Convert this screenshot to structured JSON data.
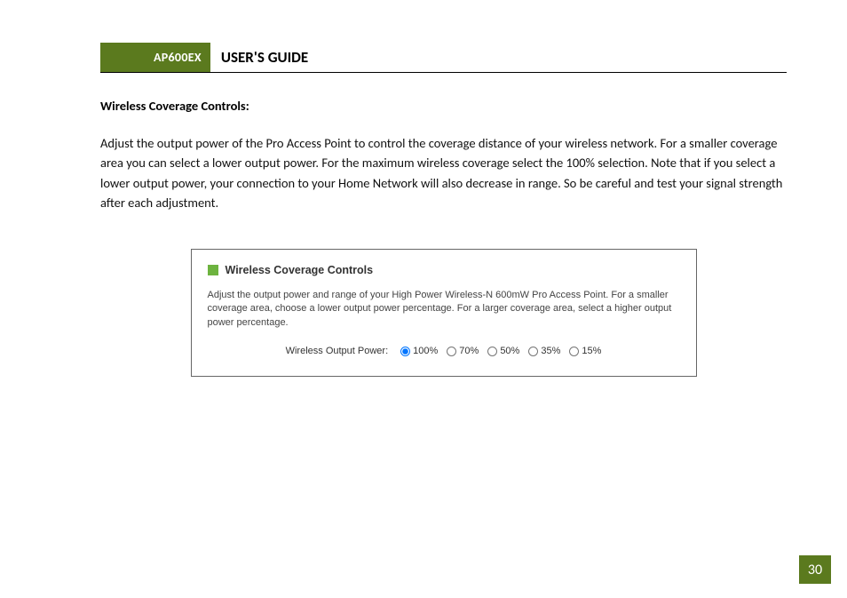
{
  "header": {
    "badge": "AP600EX",
    "title": "USER'S GUIDE"
  },
  "section": {
    "heading": "Wireless Coverage Controls:",
    "body": "Adjust the output power of the Pro Access Point to control the coverage distance of your wireless network.  For a smaller coverage area you can select a lower output power.  For the maximum wireless coverage select the 100% selection.  Note that if you select a lower output power, your connection to your Home Network will also decrease in range.  So be careful and test your signal strength after each adjustment."
  },
  "figure": {
    "title": "Wireless Coverage Controls",
    "desc": "Adjust the output power and range of your High Power Wireless-N 600mW Pro Access Point. For a smaller coverage area, choose a lower output power percentage. For a larger coverage area, select a higher output power percentage.",
    "radio_label": "Wireless Output Power:",
    "options": [
      "100%",
      "70%",
      "50%",
      "35%",
      "15%"
    ],
    "selected": "100%"
  },
  "page_number": "30"
}
